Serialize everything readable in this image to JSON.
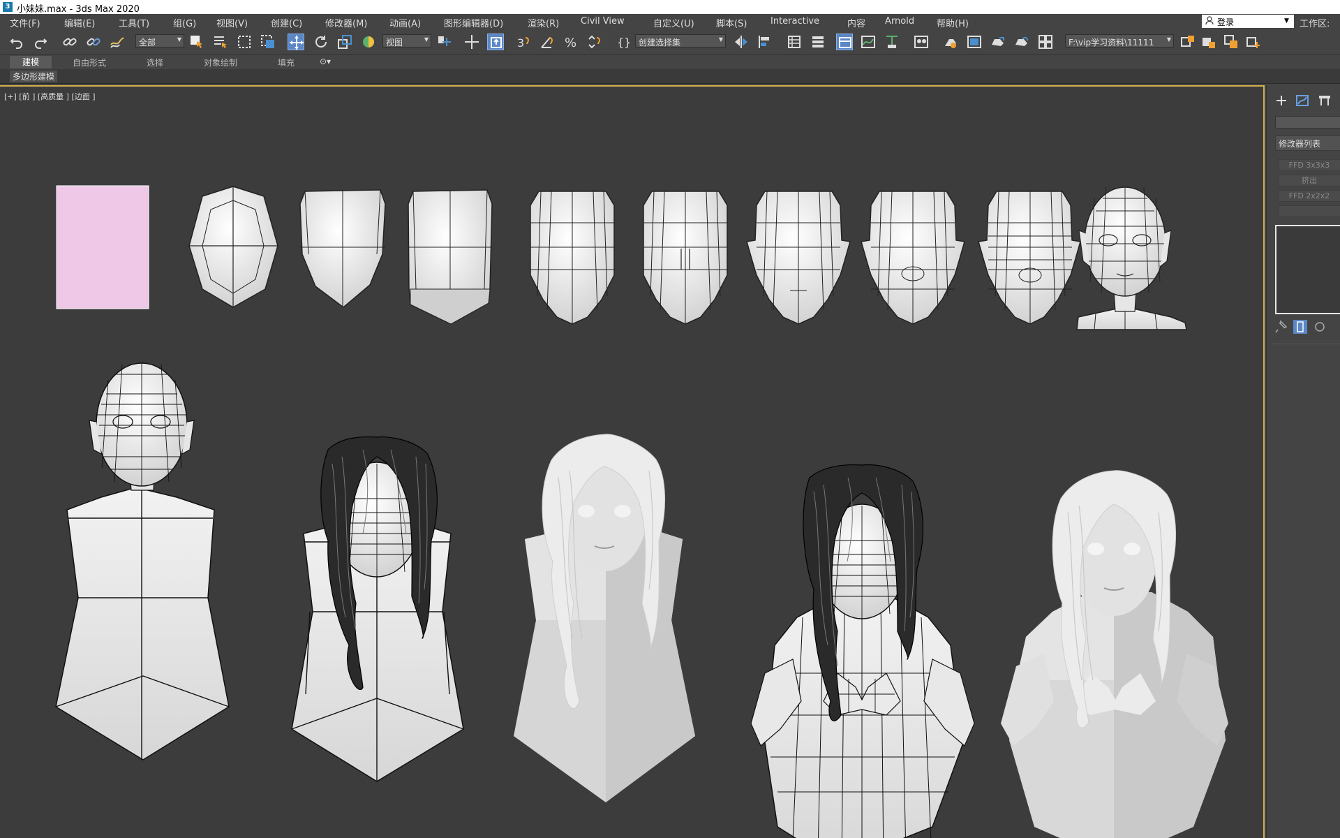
{
  "window": {
    "title": "小妹妹.max - 3ds Max 2020",
    "app_icon": "3"
  },
  "menubar": {
    "items": [
      "文件(F)",
      "编辑(E)",
      "工具(T)",
      "组(G)",
      "视图(V)",
      "创建(C)",
      "修改器(M)",
      "动画(A)",
      "图形编辑器(D)",
      "渲染(R)",
      "Civil View",
      "自定义(U)",
      "脚本(S)",
      "Interactive",
      "内容",
      "Arnold",
      "帮助(H)"
    ],
    "signin": "登录",
    "workspace_label": "工作区:"
  },
  "toolbar": {
    "selection_filter": "全部",
    "ref_coord": "视图",
    "named_selection": "创建选择集",
    "project_path": "F:\\vip学习资料\\11111"
  },
  "ribbon": {
    "tabs": [
      "建模",
      "自由形式",
      "选择",
      "对象绘制",
      "填充"
    ],
    "active_tab": "建模",
    "panel_label": "多边形建模"
  },
  "viewport": {
    "label": "[+] [前 ] [高质量 ] [边面 ]",
    "border_color": "#d2b04c",
    "background": "#3c3c3c"
  },
  "command_panel": {
    "modifier_list_label": "修改器列表",
    "modifier_buttons": [
      "FFD 3x3x3",
      "挤出",
      "FFD 2x2x2",
      ""
    ]
  }
}
